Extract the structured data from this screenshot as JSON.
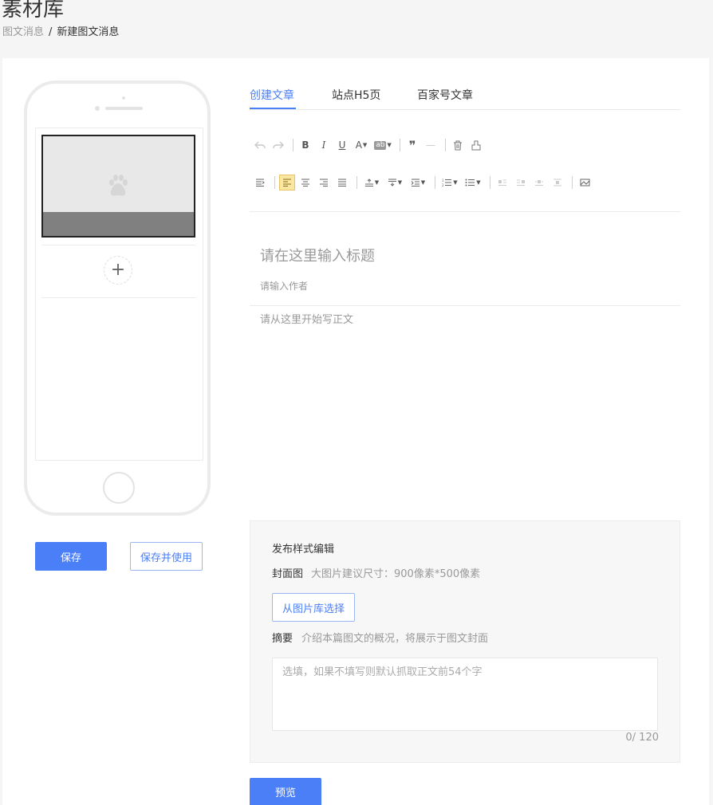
{
  "page": {
    "title": "素材库"
  },
  "breadcrumb": {
    "items": [
      "图文消息",
      "新建图文消息"
    ],
    "separator": "/"
  },
  "phone_preview": {
    "add_symbol": "+",
    "cover_icon": "baidu-paw-icon"
  },
  "actions": {
    "save": "保存",
    "save_and_use": "保存并使用",
    "preview": "预览"
  },
  "tabs": [
    {
      "label": "创建文章",
      "active": true
    },
    {
      "label": "站点H5页",
      "active": false
    },
    {
      "label": "百家号文章",
      "active": false
    }
  ],
  "toolbar": {
    "bold": "B",
    "italic": "I",
    "underline": "U",
    "font_color": "A",
    "highlight": "ab",
    "quote": "❞",
    "hr": "—"
  },
  "editor": {
    "title_placeholder": "请在这里输入标题",
    "author_placeholder": "请输入作者",
    "body_placeholder": "请从这里开始写正文"
  },
  "publish": {
    "section_title": "发布样式编辑",
    "cover_label": "封面图",
    "cover_hint": "大图片建议尺寸：900像素*500像素",
    "choose_from_library": "从图片库选择",
    "summary_label": "摘要",
    "summary_hint": "介绍本篇图文的概况，将展示于图文封面",
    "summary_placeholder": "选填，如果不填写则默认抓取正文前54个字",
    "counter": "0/ 120"
  },
  "colors": {
    "accent": "#4b7ff8",
    "cover_band": "#808080",
    "cover_bg": "#e8e8e8"
  }
}
